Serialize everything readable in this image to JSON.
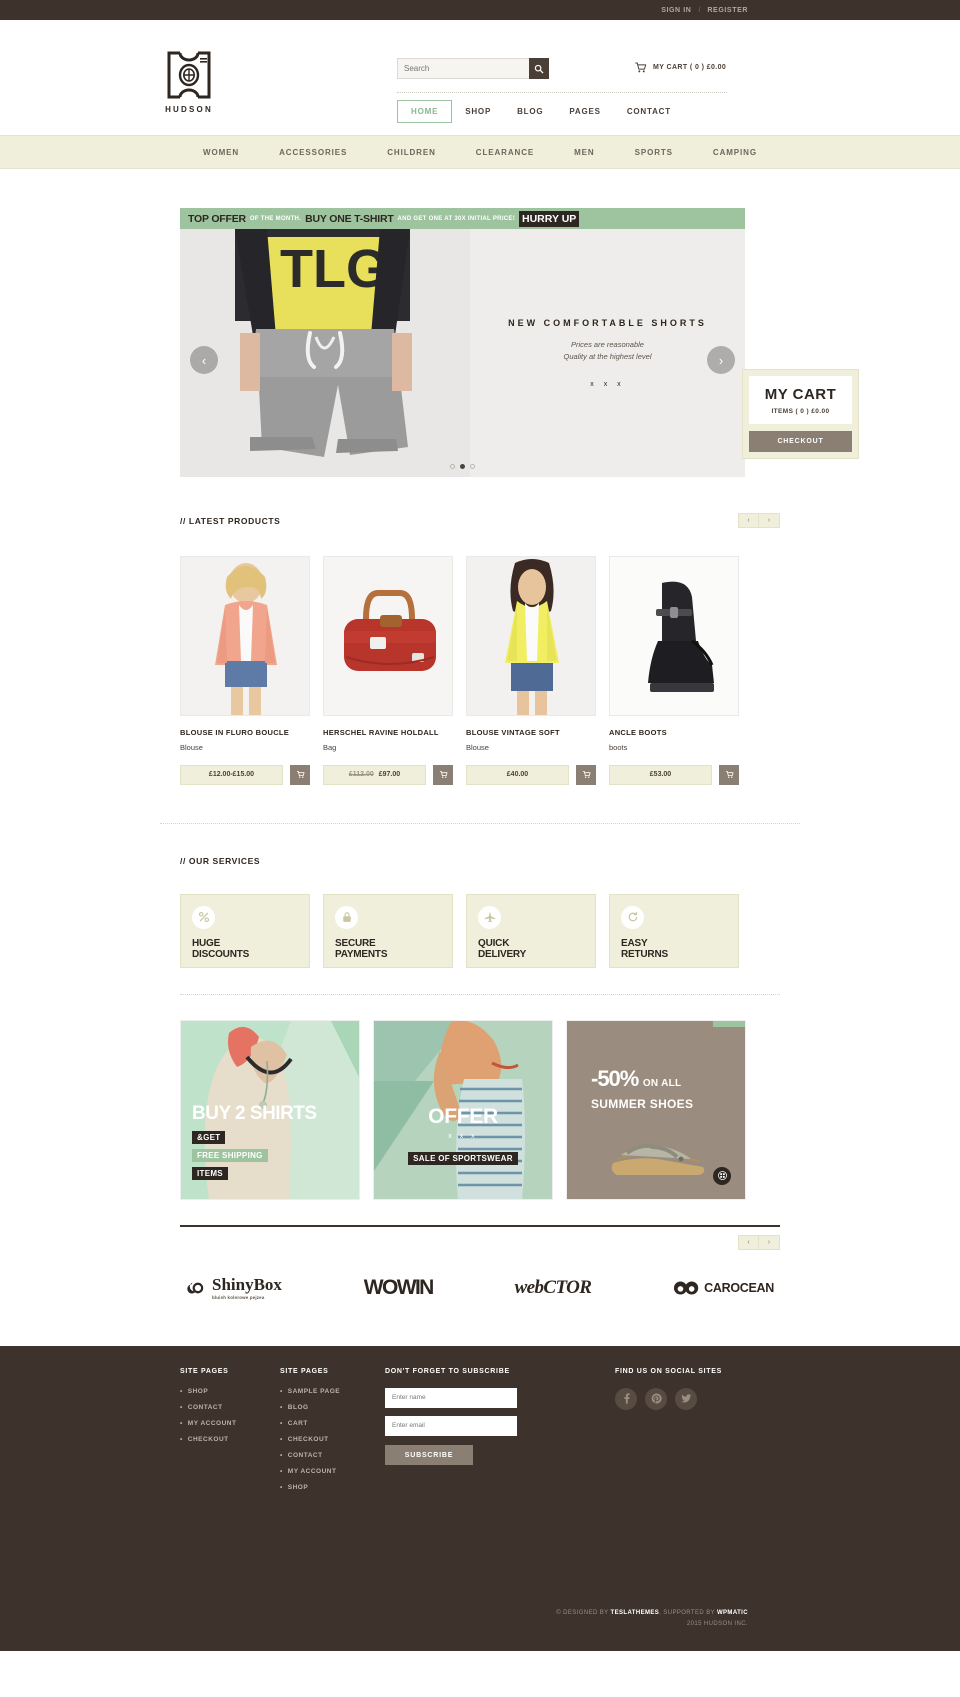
{
  "topbar": {
    "sign_in": "SIGN IN",
    "separator": "/",
    "register": "REGISTER"
  },
  "header": {
    "logo_name": "HUDSON",
    "search": {
      "placeholder": "Search",
      "value": "",
      "icon": "search-icon"
    },
    "cart": {
      "icon": "cart-icon",
      "label": "MY CART ( 0 ) £0.00"
    },
    "nav": [
      {
        "label": "HOME",
        "active": true
      },
      {
        "label": "SHOP",
        "active": false
      },
      {
        "label": "BLOG",
        "active": false
      },
      {
        "label": "PAGES",
        "active": false
      },
      {
        "label": "CONTACT",
        "active": false
      }
    ]
  },
  "categories": [
    "WOMEN",
    "ACCESSORIES",
    "CHILDREN",
    "CLEARANCE",
    "MEN",
    "SPORTS",
    "CAMPING"
  ],
  "promo_strip": {
    "bold1": "TOP OFFER",
    "small1": "OF THE MONTH.",
    "bold2": "BUY ONE T-SHIRT",
    "small2": "AND GET ONE AT 30X INITIAL PRICE!",
    "highlight": "HURRY UP"
  },
  "slider": {
    "title": "NEW COMFORTABLE SHORTS",
    "sub_line1": "Prices are reasonable",
    "sub_line2": "Quality at the highest level",
    "xxx": "x x x",
    "prev_icon": "chevron-left-icon",
    "next_icon": "chevron-right-icon",
    "dots": 3,
    "active_dot": 1
  },
  "cart_aside": {
    "title": "MY CART",
    "items": "ITEMS ( 0 ) £0.00",
    "checkout": "CHECKOUT"
  },
  "latest": {
    "heading_slash": "//",
    "heading": "LATEST PRODUCTS",
    "prev": "‹",
    "next": "›",
    "products": [
      {
        "name": "BLOUSE IN FLURO BOUCLE",
        "category": "Blouse",
        "price": "£12.00-£15.00",
        "old_price": "",
        "cart_icon": "cart-icon"
      },
      {
        "name": "HERSCHEL RAVINE HOLDALL",
        "category": "Bag",
        "price": "£97.00",
        "old_price": "£112.00",
        "cart_icon": "cart-icon"
      },
      {
        "name": "BLOUSE VINTAGE SOFT",
        "category": "Blouse",
        "price": "£40.00",
        "old_price": "",
        "cart_icon": "cart-icon"
      },
      {
        "name": "ANCLE BOOTS",
        "category": "boots",
        "price": "£53.00",
        "old_price": "",
        "cart_icon": "cart-icon"
      }
    ]
  },
  "services": {
    "heading_slash": "//",
    "heading": "OUR SERVICES",
    "items": [
      {
        "icon": "percent-icon",
        "glyph": "%",
        "line1": "HUGE",
        "line2": "DISCOUNTS"
      },
      {
        "icon": "lock-icon",
        "glyph": "🔒",
        "line1": "SECURE",
        "line2": "PAYMENTS"
      },
      {
        "icon": "airplane-icon",
        "glyph": "✈",
        "line1": "QUICK",
        "line2": "DELIVERY"
      },
      {
        "icon": "refresh-icon",
        "glyph": "↻",
        "line1": "EASY",
        "line2": "RETURNS"
      }
    ]
  },
  "tiles": [
    {
      "headline": "BUY 2 SHIRTS",
      "tag1": "&GET",
      "tag2": "FREE SHIPPING",
      "tag3": "ITEMS"
    },
    {
      "headline": "OFFER",
      "xxx": "x x x",
      "tag1": "SALE OF SPORTSWEAR"
    },
    {
      "pct": "-50%",
      "on": "ON ALL",
      "sub": "SUMMER SHOES",
      "button_icon": "grid-icon"
    }
  ],
  "brands": {
    "prev": "‹",
    "next": "›",
    "items": [
      {
        "name": "ShinyBox",
        "tagline": "bluish kolorowe pejzea"
      },
      {
        "name": "WOWIN",
        "tagline": ""
      },
      {
        "name": "webCTOR",
        "tagline": ""
      },
      {
        "name": "CAROCEAN",
        "tagline": ""
      }
    ]
  },
  "footer": {
    "col1": {
      "heading": "SITE PAGES",
      "links": [
        "SHOP",
        "CONTACT",
        "MY ACCOUNT",
        "CHECKOUT"
      ]
    },
    "col2": {
      "heading": "SITE PAGES",
      "links": [
        "SAMPLE PAGE",
        "BLOG",
        "CART",
        "CHECKOUT",
        "CONTACT",
        "MY ACCOUNT",
        "SHOP"
      ]
    },
    "subscribe": {
      "heading": "DON'T FORGET TO SUBSCRIBE",
      "name_placeholder": "Enter name",
      "name_value": "",
      "email_placeholder": "Enter email",
      "email_value": "",
      "button": "SUBSCRIBE"
    },
    "social": {
      "heading": "FIND US ON SOCIAL SITES",
      "items": [
        {
          "icon": "facebook-icon",
          "glyph": "f"
        },
        {
          "icon": "pinterest-icon",
          "glyph": "p"
        },
        {
          "icon": "twitter-icon",
          "glyph": "t"
        }
      ]
    },
    "copyright_line1_pre": "©  DESIGNED BY ",
    "copyright_brand1": "TESLATHEMES",
    "copyright_mid": ", SUPPORTED BY ",
    "copyright_brand2": "WPMATIC",
    "copyright_line2": "2015 HUDSON INC."
  },
  "colors": {
    "dark": "#3e332c",
    "green": "#9ec49f",
    "cream": "#f0efdc",
    "taupe": "#8a7f72"
  }
}
